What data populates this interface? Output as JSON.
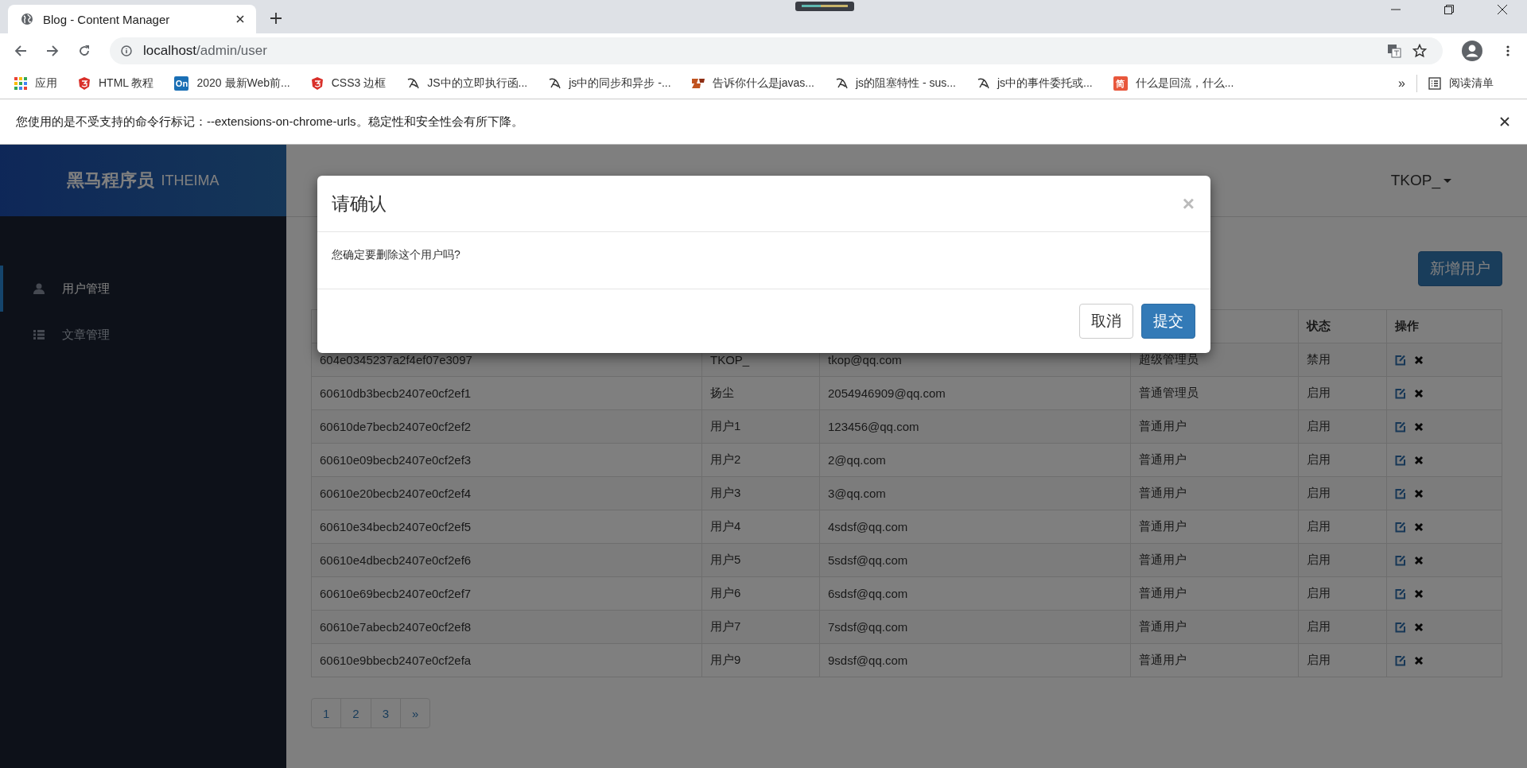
{
  "browser": {
    "tab": {
      "title": "Blog - Content Manager"
    },
    "url": {
      "host": "localhost",
      "path": "/admin/user"
    },
    "bookmarks": [
      {
        "kind": "apps",
        "label": "应用"
      },
      {
        "kind": "shield",
        "label": "HTML 教程"
      },
      {
        "kind": "badge",
        "icon_text": "On",
        "color": "#1a6fb5",
        "label": "2020 最新Web前..."
      },
      {
        "kind": "shield",
        "label": "CSS3 边框"
      },
      {
        "kind": "script",
        "label": "JS中的立即执行函..."
      },
      {
        "kind": "script",
        "label": "js中的同步和异步 -..."
      },
      {
        "kind": "logo",
        "label": "告诉你什么是javas..."
      },
      {
        "kind": "script",
        "label": "js的阻塞特性 - sus..."
      },
      {
        "kind": "script",
        "label": "js中的事件委托或..."
      },
      {
        "kind": "badge",
        "icon_text": "简",
        "color": "#e8573c",
        "label": "什么是回流，什么..."
      }
    ],
    "more": "»",
    "reading_list": "阅读清单",
    "infobar": "您使用的是不受支持的命令行标记：--extensions-on-chrome-urls。稳定性和安全性会有所下降。"
  },
  "app": {
    "logo": {
      "name": "黑马程序员",
      "latin": "ITHEIMA"
    },
    "sidebar": {
      "items": [
        {
          "kind": "user",
          "label": "用户管理",
          "selected": true
        },
        {
          "kind": "list",
          "label": "文章管理",
          "selected": false
        }
      ]
    },
    "user_menu": "TKOP_",
    "new_button": "新增用户",
    "table": {
      "headers": [
        {
          "label": "状态"
        },
        {
          "label": "操作"
        }
      ],
      "rows": [
        {
          "id": "604e0345237a2f4ef07e3097",
          "name": "TKOP_",
          "email": "tkop@qq.com",
          "role": "超级管理员",
          "status": "禁用"
        },
        {
          "id": "60610db3becb2407e0cf2ef1",
          "name": "扬尘",
          "email": "2054946909@qq.com",
          "role": "普通管理员",
          "status": "启用"
        },
        {
          "id": "60610de7becb2407e0cf2ef2",
          "name": "用户1",
          "email": "123456@qq.com",
          "role": "普通用户",
          "status": "启用"
        },
        {
          "id": "60610e09becb2407e0cf2ef3",
          "name": "用户2",
          "email": "2@qq.com",
          "role": "普通用户",
          "status": "启用"
        },
        {
          "id": "60610e20becb2407e0cf2ef4",
          "name": "用户3",
          "email": "3@qq.com",
          "role": "普通用户",
          "status": "启用"
        },
        {
          "id": "60610e34becb2407e0cf2ef5",
          "name": "用户4",
          "email": "4sdsf@qq.com",
          "role": "普通用户",
          "status": "启用"
        },
        {
          "id": "60610e4dbecb2407e0cf2ef6",
          "name": "用户5",
          "email": "5sdsf@qq.com",
          "role": "普通用户",
          "status": "启用"
        },
        {
          "id": "60610e69becb2407e0cf2ef7",
          "name": "用户6",
          "email": "6sdsf@qq.com",
          "role": "普通用户",
          "status": "启用"
        },
        {
          "id": "60610e7abecb2407e0cf2ef8",
          "name": "用户7",
          "email": "7sdsf@qq.com",
          "role": "普通用户",
          "status": "启用"
        },
        {
          "id": "60610e9bbecb2407e0cf2efa",
          "name": "用户9",
          "email": "9sdsf@qq.com",
          "role": "普通用户",
          "status": "启用"
        }
      ]
    },
    "pagination": [
      "1",
      "2",
      "3",
      "»"
    ]
  },
  "modal": {
    "title": "请确认",
    "message": "您确定要删除这个用户吗?",
    "close": "×",
    "buttons": [
      {
        "kind": "default",
        "label": "取消"
      },
      {
        "kind": "primary",
        "label": "提交"
      }
    ]
  }
}
